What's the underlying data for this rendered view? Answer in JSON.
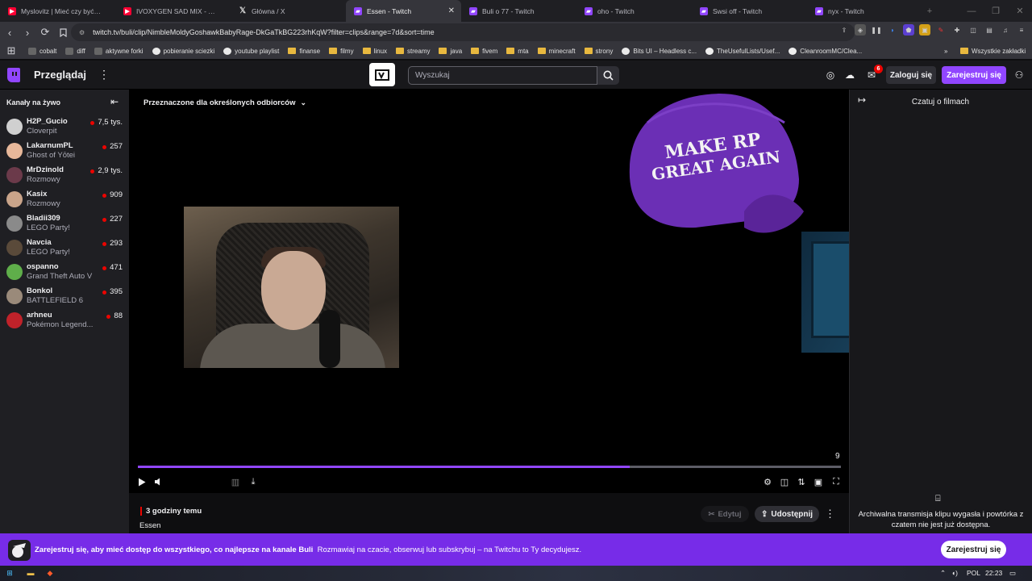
{
  "browser": {
    "tabs": [
      {
        "title": "Myslovitz | Mieć czy być - You",
        "favicon": "youtube-icon"
      },
      {
        "title": "IVOXYGEN SAD MIX - YouTube",
        "favicon": "youtube-icon"
      },
      {
        "title": "Główna / X",
        "favicon": "x-icon"
      },
      {
        "title": "Essen - Twitch",
        "favicon": "twitch-icon",
        "active": true
      },
      {
        "title": "Buli o 77 - Twitch",
        "favicon": "twitch-icon"
      },
      {
        "title": "oho - Twitch",
        "favicon": "twitch-icon"
      },
      {
        "title": "Swsi off - Twitch",
        "favicon": "twitch-icon"
      },
      {
        "title": "nyx - Twitch",
        "favicon": "twitch-icon"
      }
    ],
    "new_tab": "+",
    "url": "twitch.tv/buli/clip/NimbleMoldyGoshawkBabyRage-DkGaTkBG223rhKqW?filter=clips&range=7d&sort=time",
    "bookmarks": [
      "cobalt",
      "diff",
      "aktywne forki",
      "pobieranie sciezki",
      "youtube playlist",
      "finanse",
      "filmy",
      "linux",
      "streamy",
      "java",
      "fivem",
      "mta",
      "minecraft",
      "strony",
      "Bits UI – Headless c...",
      "TheUsefulLists/Usef...",
      "CleanroomMC/Clea..."
    ],
    "bookmarks_more": "»",
    "all_bookmarks": "Wszystkie zakładki"
  },
  "topnav": {
    "browse": "Przeglądaj",
    "search_placeholder": "Wyszukaj",
    "notifications_count": "6",
    "login": "Zaloguj się",
    "signup": "Zarejestruj się"
  },
  "sidebar": {
    "header": "Kanały na żywo",
    "channels": [
      {
        "name": "H2P_Gucio",
        "game": "Cloverpit",
        "viewers": "7,5 tys.",
        "color": "#d0d0d0"
      },
      {
        "name": "LakarnumPL",
        "game": "Ghost of Yōtei",
        "viewers": "257",
        "color": "#e8b89a"
      },
      {
        "name": "MrDzinold",
        "game": "Rozmowy",
        "viewers": "2,9 tys.",
        "color": "#6b3a4a"
      },
      {
        "name": "Kasix",
        "game": "Rozmowy",
        "viewers": "909",
        "color": "#c9a48a"
      },
      {
        "name": "Bladii309",
        "game": "LEGO Party!",
        "viewers": "227",
        "color": "#8a8a8a"
      },
      {
        "name": "Navcia",
        "game": "LEGO Party!",
        "viewers": "293",
        "color": "#5a4a3a"
      },
      {
        "name": "ospanno",
        "game": "Grand Theft Auto V",
        "viewers": "471",
        "color": "#5fae4a"
      },
      {
        "name": "Bonkol",
        "game": "BATTLEFIELD 6",
        "viewers": "395",
        "color": "#9a8a7a"
      },
      {
        "name": "arhneu",
        "game": "Pokémon Legend...",
        "viewers": "88",
        "color": "#c0222a"
      }
    ]
  },
  "player": {
    "audience": "Przeznaczone dla określonych odbiorców",
    "cap_line1": "MAKE RP",
    "cap_line2": "GREAT AGAIN",
    "timecode": "9",
    "progress": 0.7
  },
  "clip": {
    "ago": "3 godziny temu",
    "title": "Essen",
    "edit": "Edytuj",
    "share": "Udostępnij"
  },
  "chat": {
    "title": "Czatuj o filmach",
    "message": "Archiwalna transmisja klipu wygasła i powtórka z czatem nie jest już dostępna."
  },
  "banner": {
    "bold": "Zarejestruj się, aby mieć dostęp do wszystkiego, co najlepsze na kanale Buli",
    "rest": "Rozmawiaj na czacie, obserwuj lub subskrybuj – na Twitchu to Ty decydujesz.",
    "button": "Zarejestruj się"
  },
  "taskbar": {
    "lang": "POL",
    "time": "22:23"
  },
  "colors": {
    "twitch_purple": "#9146ff",
    "banner_purple": "#772ce8",
    "live_red": "#eb0400"
  }
}
